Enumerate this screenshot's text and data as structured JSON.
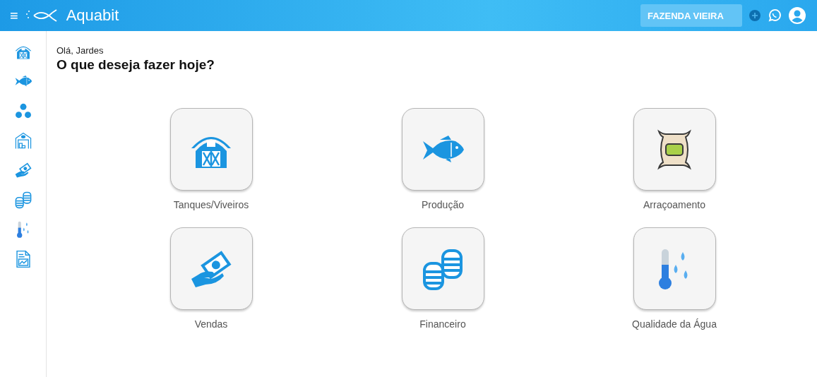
{
  "header": {
    "menu_icon": "≡",
    "app_name": "Aquabit",
    "farm_select": {
      "value": "FAZENDA VIEIRA"
    }
  },
  "sidebar": {
    "items": [
      {
        "kind": "barn"
      },
      {
        "kind": "fish"
      },
      {
        "kind": "dots"
      },
      {
        "kind": "warehouse"
      },
      {
        "kind": "money"
      },
      {
        "kind": "coins"
      },
      {
        "kind": "thermo"
      },
      {
        "kind": "report"
      }
    ]
  },
  "greeting": "Olá, Jardes",
  "heading": "O que deseja fazer hoje?",
  "tiles": [
    {
      "label": "Tanques/Viveiros",
      "kind": "barn"
    },
    {
      "label": "Produção",
      "kind": "fish"
    },
    {
      "label": "Arraçoamento",
      "kind": "sack"
    },
    {
      "label": "Vendas",
      "kind": "money"
    },
    {
      "label": "Financeiro",
      "kind": "coins"
    },
    {
      "label": "Qualidade da Água",
      "kind": "thermo"
    }
  ]
}
